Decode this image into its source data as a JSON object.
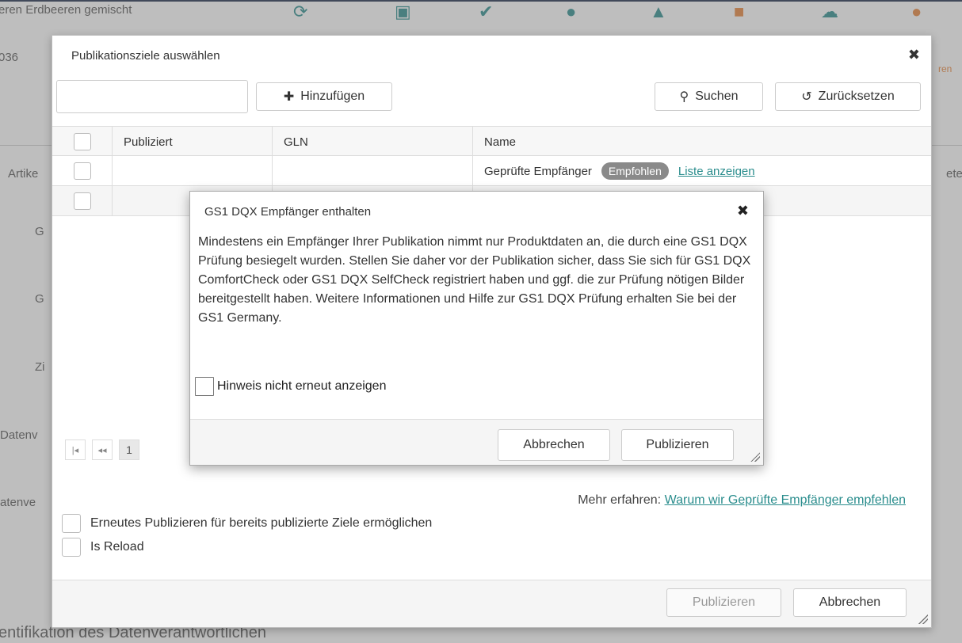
{
  "background": {
    "product_title": "eren Erdbeeren gemischt",
    "product_code": "036",
    "right_label": "ren",
    "side_labels": [
      "Artike",
      "G",
      "G",
      "Zi",
      "Datenv",
      "atenve"
    ],
    "right_label_2": "etex",
    "bottom_text": "entifikation des Datenverantwortlichen",
    "toolbar_icon_colors": [
      "#2a8d8d",
      "#2a8d8d",
      "#2a8d8d",
      "#2a8d8d",
      "#2a8d8d",
      "#e8843a",
      "#2a8d8d",
      "#e8843a"
    ]
  },
  "dialog": {
    "title": "Publikationsziele auswählen",
    "search_placeholder": "",
    "add_label": "Hinzufügen",
    "search_label": "Suchen",
    "reset_label": "Zurücksetzen",
    "grid": {
      "columns": [
        "",
        "Publiziert",
        "GLN",
        "Name"
      ],
      "rows": [
        {
          "publiziert": "",
          "gln": "",
          "name": "Geprüfte Empfänger",
          "badge": "Empfohlen",
          "link": "Liste anzeigen"
        },
        {
          "publiziert": "",
          "gln": "",
          "name": ""
        }
      ]
    },
    "pager": {
      "first": "|◂",
      "prev": "◂◂",
      "page": "1"
    },
    "more_info_label": "Mehr erfahren:",
    "more_info_link": "Warum wir Geprüfte Empfänger empfehlen",
    "option_republish": "Erneutes Publizieren für bereits publizierte Ziele ermöglichen",
    "option_reload": "Is Reload",
    "footer": {
      "publish_label": "Publizieren",
      "cancel_label": "Abbrechen"
    }
  },
  "alert": {
    "title": "GS1 DQX Empfänger enthalten",
    "message": "Mindestens ein Empfänger Ihrer Publikation nimmt nur Produktdaten an, die durch eine GS1 DQX Prüfung besiegelt wurden. Stellen Sie daher vor der Publikation sicher, dass Sie sich für GS1 DQX ComfortCheck oder GS1 DQX SelfCheck registriert haben und ggf. die zur Prüfung nötigen Bilder bereitgestellt haben. Weitere Informationen und Hilfe zur GS1 DQX Prüfung erhalten Sie bei der GS1 Germany.",
    "checkbox_label": "Hinweis nicht erneut anzeigen",
    "cancel_label": "Abbrechen",
    "publish_label": "Publizieren"
  }
}
